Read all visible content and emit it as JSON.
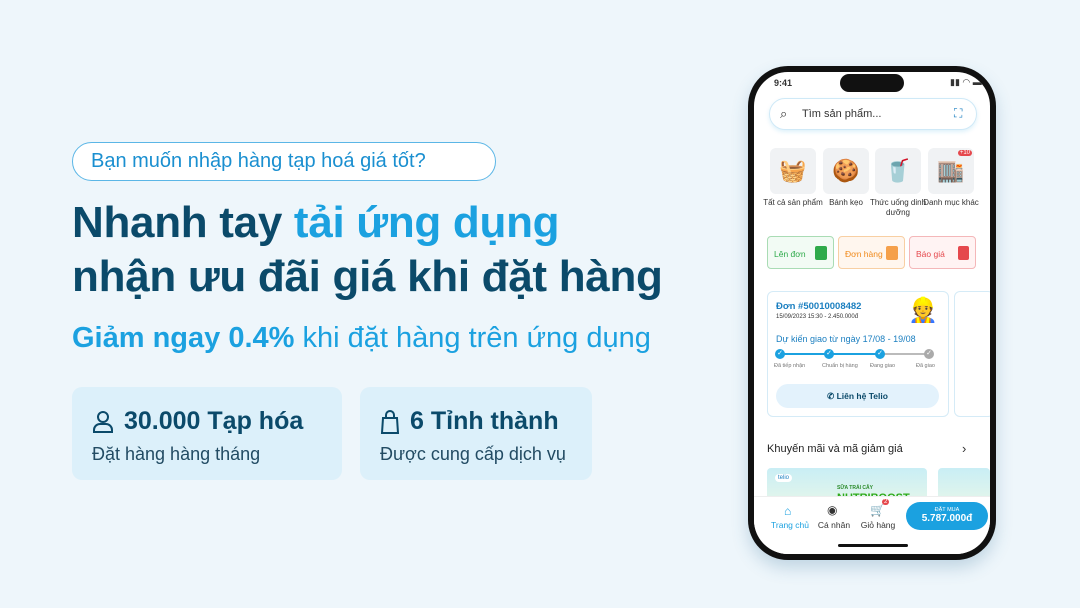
{
  "left": {
    "tagline": "Bạn muốn nhập hàng tạp hoá giá tốt?",
    "headline_1a": "Nhanh tay ",
    "headline_1b": "tải ứng dụng",
    "headline_2": "nhận ưu đãi giá khi đặt hàng",
    "sub_bold": "Giảm ngay 0.4%",
    "sub_rest": " khi đặt hàng trên ứng dụng",
    "stats": [
      {
        "icon": "user-icon",
        "title": "30.000 Tạp hóa",
        "desc": "Đặt hàng hàng tháng"
      },
      {
        "icon": "shopping-bag-icon",
        "title": "6 Tỉnh thành",
        "desc": "Được cung cấp dịch vụ"
      }
    ]
  },
  "phone": {
    "time": "9:41",
    "search_placeholder": "Tìm sản phẩm...",
    "categories": [
      {
        "label": "Tất cả sản phẩm"
      },
      {
        "label": "Bánh kẹo"
      },
      {
        "label": "Thức uống dinh dưỡng"
      },
      {
        "label": "Danh mục khác",
        "badge": "+10"
      }
    ],
    "quick_actions": [
      {
        "label": "Lên đơn",
        "color": "#2eaa4a"
      },
      {
        "label": "Đơn hàng",
        "color": "#f08a1c"
      },
      {
        "label": "Báo giá",
        "color": "#e5484d"
      }
    ],
    "order": {
      "title": "Đơn #50010008482",
      "meta": "15/09/2023 15:30 - 2.450.000đ",
      "eta": "Dự kiến giao từ ngày 17/08 - 19/08",
      "steps": [
        {
          "label": "Đã tiếp nhận",
          "done": true
        },
        {
          "label": "Chuẩn bị hàng",
          "done": true
        },
        {
          "label": "Đang giao",
          "done": true
        },
        {
          "label": "Đã giao",
          "done": false
        }
      ],
      "contact": "Liên hệ Telio"
    },
    "promo_title": "Khuyến mãi và mã giảm giá",
    "banner_brand": "telio",
    "banner_small": "SỮA TRÁI CÂY",
    "banner_big": "NUTRIBOOST",
    "nav": [
      {
        "label": "Trang chủ",
        "active": true
      },
      {
        "label": "Cá nhân"
      },
      {
        "label": "Giỏ hàng",
        "badge": "2"
      }
    ],
    "buy_label": "ĐẶT MUA",
    "buy_total": "5.787.000đ"
  },
  "colors": {
    "accent": "#1ba1e0",
    "navy": "#0b4a6a",
    "bg": "#eef6fb"
  }
}
